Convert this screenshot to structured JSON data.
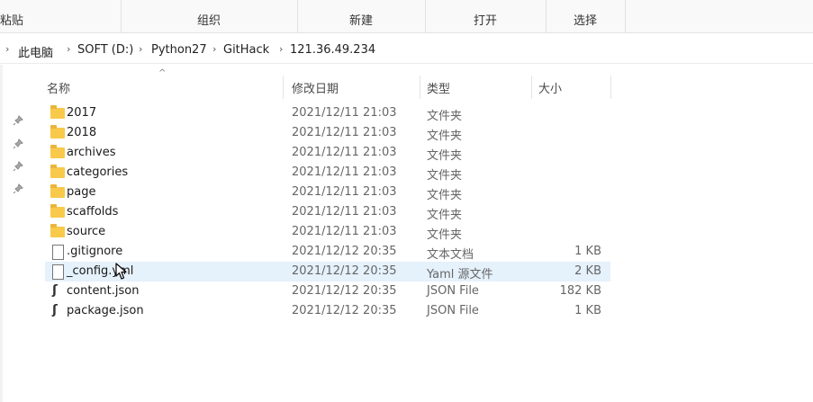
{
  "ribbon": {
    "groups": [
      "粘贴",
      "组织",
      "新建",
      "打开",
      "选择"
    ]
  },
  "address": {
    "crumbs": [
      "此电脑",
      "SOFT (D:)",
      "Python27",
      "GitHack",
      "121.36.49.234"
    ]
  },
  "columns": {
    "name": "名称",
    "date": "修改日期",
    "type": "类型",
    "size": "大小"
  },
  "files": [
    {
      "name": "2017",
      "date": "2021/12/11 21:03",
      "type": "文件夹",
      "size": "",
      "icon": "folder-icon"
    },
    {
      "name": "2018",
      "date": "2021/12/11 21:03",
      "type": "文件夹",
      "size": "",
      "icon": "folder-icon"
    },
    {
      "name": "archives",
      "date": "2021/12/11 21:03",
      "type": "文件夹",
      "size": "",
      "icon": "folder-icon"
    },
    {
      "name": "categories",
      "date": "2021/12/11 21:03",
      "type": "文件夹",
      "size": "",
      "icon": "folder-icon"
    },
    {
      "name": "page",
      "date": "2021/12/11 21:03",
      "type": "文件夹",
      "size": "",
      "icon": "folder-icon"
    },
    {
      "name": "scaffolds",
      "date": "2021/12/11 21:03",
      "type": "文件夹",
      "size": "",
      "icon": "folder-icon"
    },
    {
      "name": "source",
      "date": "2021/12/11 21:03",
      "type": "文件夹",
      "size": "",
      "icon": "folder-icon"
    },
    {
      "name": ".gitignore",
      "date": "2021/12/12 20:35",
      "type": "文本文档",
      "size": "1 KB",
      "icon": "text-file-icon"
    },
    {
      "name": "_config.yml",
      "date": "2021/12/12 20:35",
      "type": "Yaml 源文件",
      "size": "2 KB",
      "icon": "yaml-file-icon"
    },
    {
      "name": "content.json",
      "date": "2021/12/12 20:35",
      "type": "JSON File",
      "size": "182 KB",
      "icon": "json-file-icon"
    },
    {
      "name": "package.json",
      "date": "2021/12/12 20:35",
      "type": "JSON File",
      "size": "1 KB",
      "icon": "json-file-icon"
    }
  ]
}
